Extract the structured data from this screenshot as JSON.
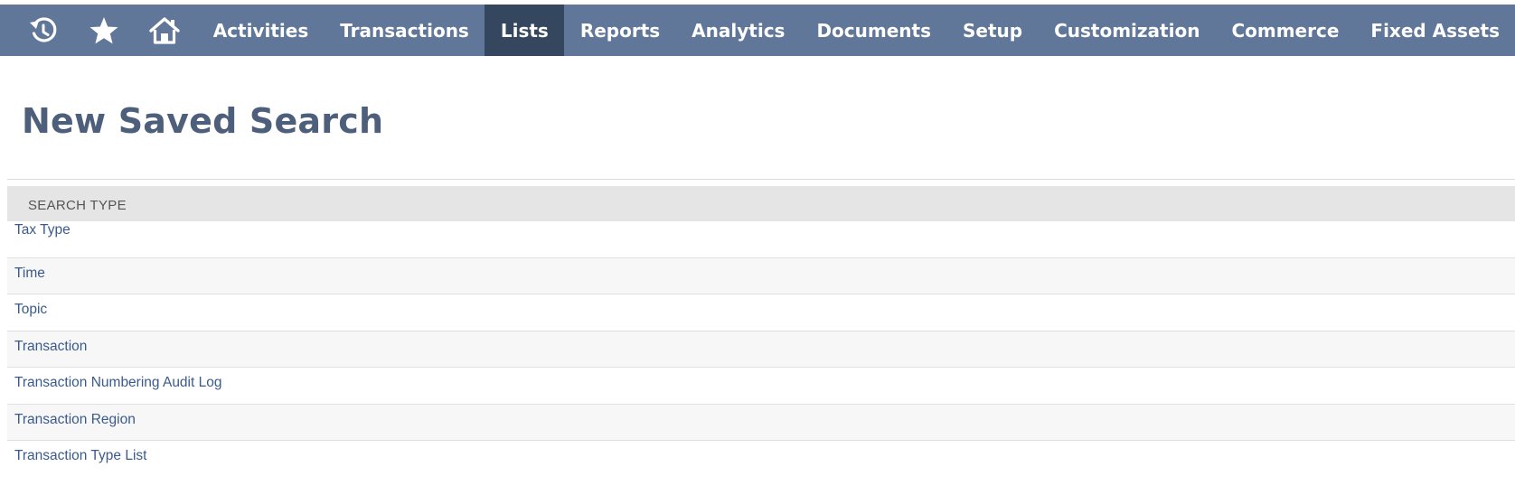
{
  "navbar": {
    "icons": [
      "recent-history-icon",
      "star-icon",
      "home-icon"
    ],
    "items": [
      {
        "label": "Activities",
        "active": false
      },
      {
        "label": "Transactions",
        "active": false
      },
      {
        "label": "Lists",
        "active": true
      },
      {
        "label": "Reports",
        "active": false
      },
      {
        "label": "Analytics",
        "active": false
      },
      {
        "label": "Documents",
        "active": false
      },
      {
        "label": "Setup",
        "active": false
      },
      {
        "label": "Customization",
        "active": false
      },
      {
        "label": "Commerce",
        "active": false
      },
      {
        "label": "Fixed Assets",
        "active": false
      }
    ]
  },
  "page": {
    "title": "New Saved Search"
  },
  "search_type": {
    "header": "SEARCH TYPE",
    "items": [
      "Tax Type",
      "Time",
      "Topic",
      "Transaction",
      "Transaction Numbering Audit Log",
      "Transaction Region",
      "Transaction Type List"
    ]
  },
  "colors": {
    "navbar_bg": "#607799",
    "navbar_active_bg": "#34475f",
    "title_color": "#4d5f7a",
    "link_color": "#3a5a8c",
    "header_bg": "#e5e5e5"
  }
}
